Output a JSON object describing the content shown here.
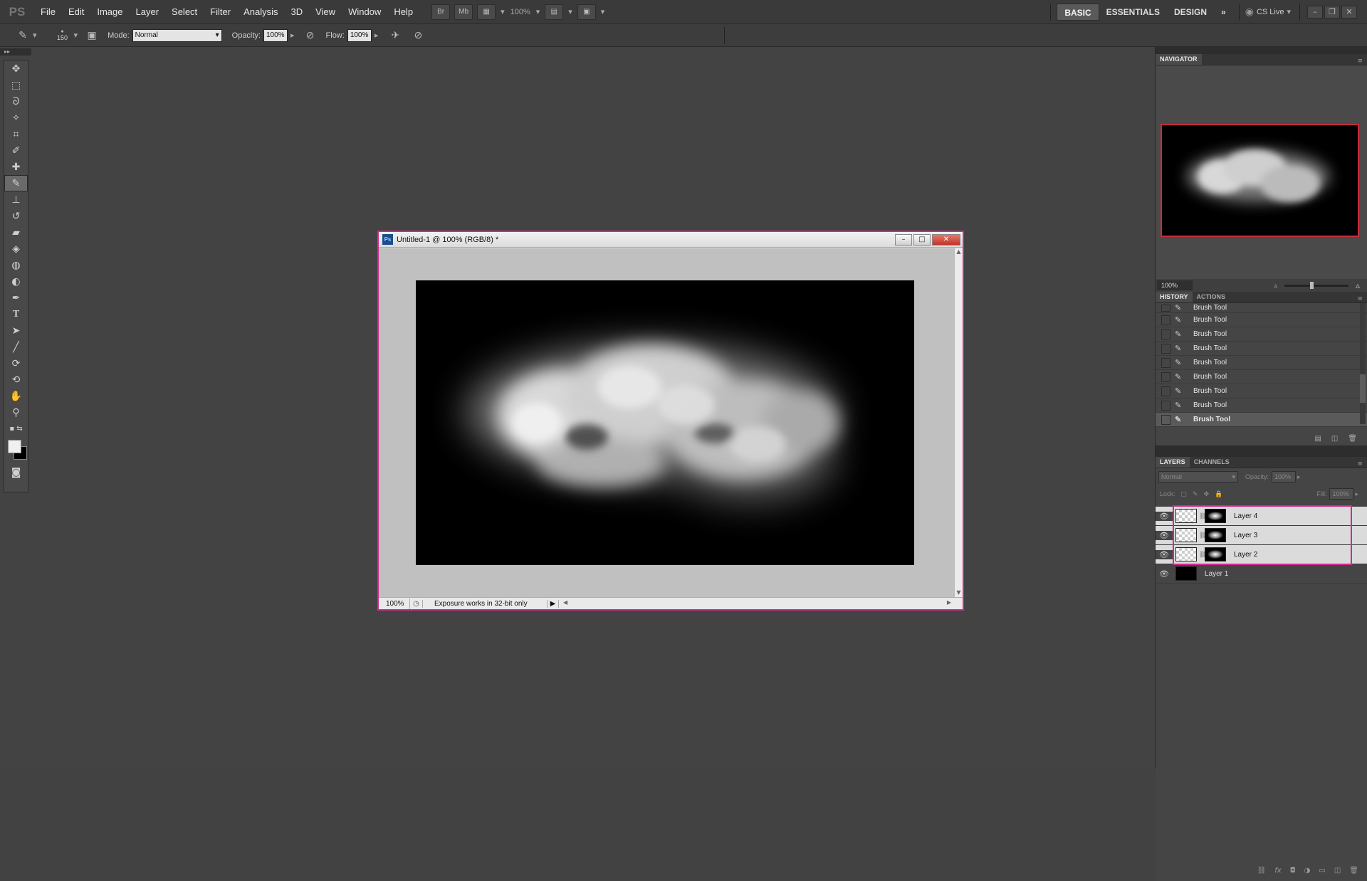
{
  "menubar": {
    "logo": "PS",
    "items": [
      "File",
      "Edit",
      "Image",
      "Layer",
      "Select",
      "Filter",
      "Analysis",
      "3D",
      "View",
      "Window",
      "Help"
    ],
    "bridge": "Br",
    "minibridge": "Mb",
    "zoom": "100%",
    "workspaces": [
      "BASIC",
      "ESSENTIALS",
      "DESIGN"
    ],
    "more": "»",
    "cslive": "CS Live"
  },
  "options": {
    "brush_size": "150",
    "mode_label": "Mode:",
    "mode_value": "Normal",
    "opacity_label": "Opacity:",
    "opacity_value": "100%",
    "flow_label": "Flow:",
    "flow_value": "100%"
  },
  "document": {
    "title": "Untitled-1 @ 100% (RGB/8) *",
    "ps_badge": "Ps",
    "zoom": "100%",
    "status": "Exposure works in 32-bit only"
  },
  "navigator": {
    "tab": "NAVIGATOR",
    "zoom": "100%"
  },
  "history": {
    "tabs": [
      "HISTORY",
      "ACTIONS"
    ],
    "items": [
      "Brush Tool",
      "Brush Tool",
      "Brush Tool",
      "Brush Tool",
      "Brush Tool",
      "Brush Tool",
      "Brush Tool",
      "Brush Tool",
      "Brush Tool"
    ]
  },
  "layers": {
    "tabs": [
      "LAYERS",
      "CHANNELS"
    ],
    "blend_mode": "Normal",
    "opacity_label": "Opacity:",
    "opacity_value": "100%",
    "lock_label": "Lock:",
    "fill_label": "Fill:",
    "fill_value": "100%",
    "items": [
      "Layer 4",
      "Layer 3",
      "Layer 2",
      "Layer 1"
    ]
  },
  "colors": {
    "highlight": "#d6288f",
    "nav_frame": "#c62d3c"
  }
}
